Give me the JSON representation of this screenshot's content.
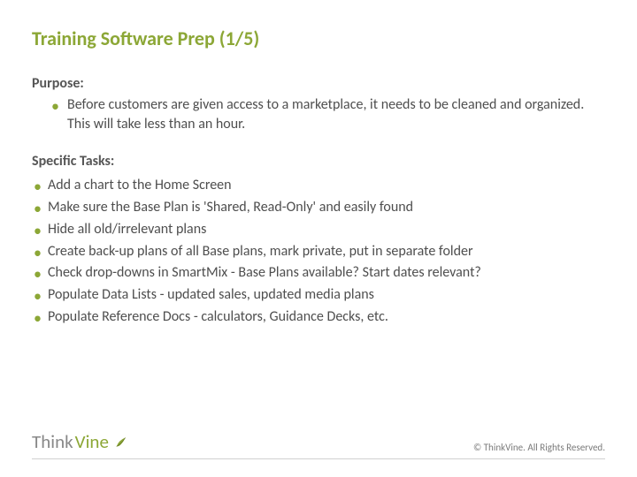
{
  "title": "Training Software Prep (1/5)",
  "purpose": {
    "label": "Purpose:",
    "text": "Before customers are given access to a marketplace, it needs to be cleaned and organized. This will take less than an hour."
  },
  "tasks_label": "Specific Tasks:",
  "tasks": [
    "Add a chart to the Home Screen",
    "Make sure the Base Plan is 'Shared, Read-Only' and easily found",
    "Hide all old/irrelevant plans",
    "Create back-up plans of all Base plans, mark private, put in separate folder",
    "Check drop-downs in SmartMix - Base Plans available? Start dates relevant?",
    "Populate Data Lists - updated sales, updated media plans",
    "Populate Reference Docs - calculators, Guidance Decks, etc."
  ],
  "logo": {
    "part1": "Think",
    "part2": "Vine"
  },
  "copyright": "© ThinkVine.  All Rights Reserved."
}
